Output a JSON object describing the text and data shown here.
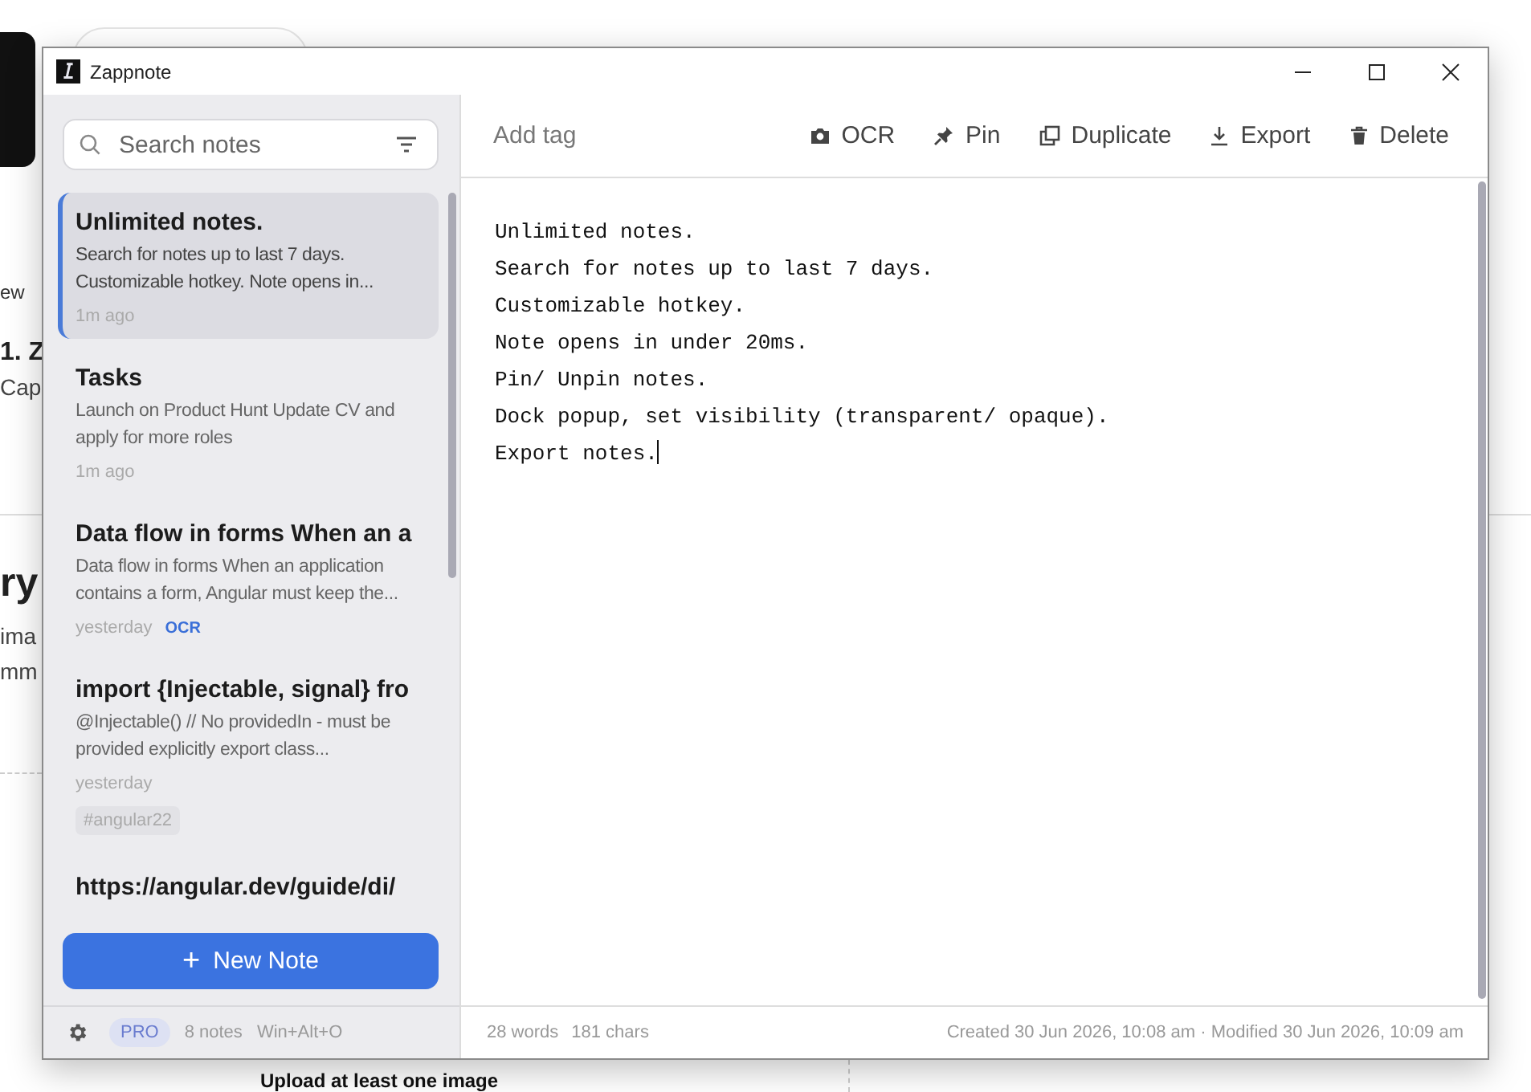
{
  "background_page": {
    "texts": [
      {
        "kind": "small",
        "text": "ew"
      },
      {
        "kind": "heading",
        "text": "1. Z"
      },
      {
        "kind": "body",
        "text": "Cap"
      },
      {
        "kind": "title",
        "text": "ry"
      },
      {
        "kind": "body",
        "text": "ima"
      },
      {
        "kind": "body",
        "text": "mm"
      }
    ],
    "upload_hint": "Upload at least one image"
  },
  "window": {
    "title": "Zappnote"
  },
  "sidebar": {
    "search": {
      "placeholder": "Search notes"
    },
    "notes": [
      {
        "title": "Unlimited notes.",
        "preview": "Search for notes up to last 7 days. Customizable hotkey. Note opens in...",
        "time": "1m ago",
        "selected": true
      },
      {
        "title": "Tasks",
        "preview": "Launch on Product Hunt Update CV and apply for more roles",
        "time": "1m ago",
        "selected": false
      },
      {
        "title": "Data flow in forms When an a",
        "preview": "Data flow in forms When an application contains a form, Angular must keep the...",
        "time": "yesterday",
        "badge": "OCR",
        "selected": false
      },
      {
        "title": "import {Injectable, signal} fro",
        "preview": "@Injectable() // No providedIn - must be provided explicitly export class...",
        "time": "yesterday",
        "tag": "#angular22",
        "selected": false
      },
      {
        "title": "https://angular.dev/guide/di/",
        "selected": false
      }
    ],
    "new_note_button": {
      "icon": "+",
      "label": "New Note"
    },
    "footer": {
      "plan": "PRO",
      "count": "8 notes",
      "hotkey": "Win+Alt+O"
    }
  },
  "toolbar": {
    "tag_field": {
      "placeholder": "Add tag"
    },
    "buttons": [
      {
        "kind": "camera",
        "label": "OCR"
      },
      {
        "kind": "pin",
        "label": "Pin"
      },
      {
        "kind": "copy",
        "label": "Duplicate"
      },
      {
        "kind": "download",
        "label": "Export"
      },
      {
        "kind": "trash",
        "label": "Delete"
      }
    ]
  },
  "editor": {
    "lines": [
      "Unlimited notes.",
      "Search for notes up to last 7 days.",
      "Customizable hotkey.",
      "Note opens in under 20ms.",
      "Pin/ Unpin notes.",
      "Dock popup, set visibility (transparent/ opaque).",
      "Export notes."
    ]
  },
  "status_bar": {
    "words": "28 words",
    "chars": "181 chars",
    "dates": "Created 30 Jun 2026, 10:08 am · Modified 30 Jun 2026, 10:09 am"
  }
}
